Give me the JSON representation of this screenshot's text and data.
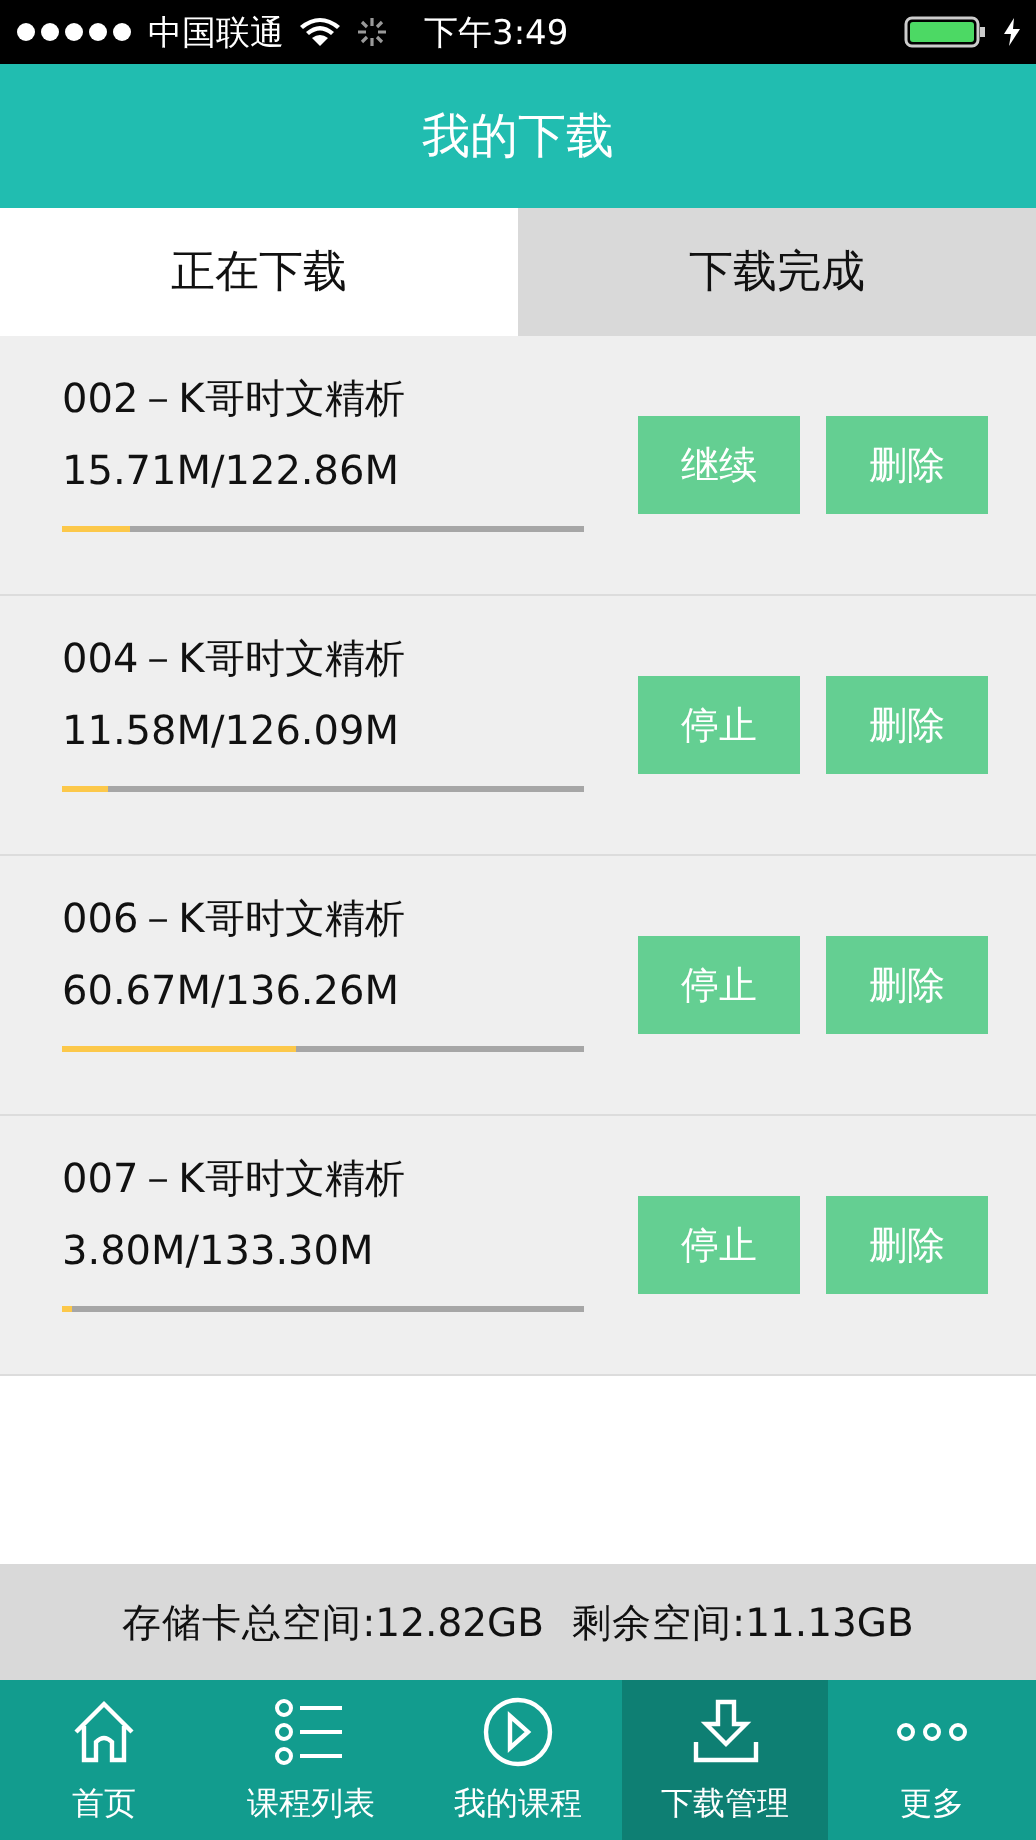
{
  "status_bar": {
    "carrier": "中国联通",
    "time": "下午3:49"
  },
  "header": {
    "title": "我的下载"
  },
  "tabs": [
    {
      "label": "正在下载",
      "selected": true
    },
    {
      "label": "下载完成",
      "selected": false
    }
  ],
  "downloads": [
    {
      "title": "002－K哥时文精析",
      "size": "15.71M/122.86M",
      "level": 0.13,
      "buttons": [
        "继续",
        "删除"
      ]
    },
    {
      "title": "004－K哥时文精析",
      "size": "11.58M/126.09M",
      "level": 0.09,
      "buttons": [
        "停止",
        "删除"
      ]
    },
    {
      "title": "006－K哥时文精析",
      "size": "60.67M/136.26M",
      "level": 0.45,
      "buttons": [
        "停止",
        "删除"
      ]
    },
    {
      "title": "007－K哥时文精析",
      "size": "3.80M/133.30M",
      "level": 0.02,
      "buttons": [
        "停止",
        "删除"
      ]
    }
  ],
  "storage": {
    "total": "存储卡总空间:12.82GB",
    "free": "剩余空间:11.13GB"
  },
  "tab_bar": [
    {
      "label": "首页",
      "kind": "home",
      "selected": false
    },
    {
      "label": "课程列表",
      "kind": "list",
      "selected": false
    },
    {
      "label": "我的课程",
      "kind": "play",
      "selected": false
    },
    {
      "label": "下载管理",
      "kind": "download",
      "selected": true
    },
    {
      "label": "更多",
      "kind": "more",
      "selected": false
    }
  ]
}
